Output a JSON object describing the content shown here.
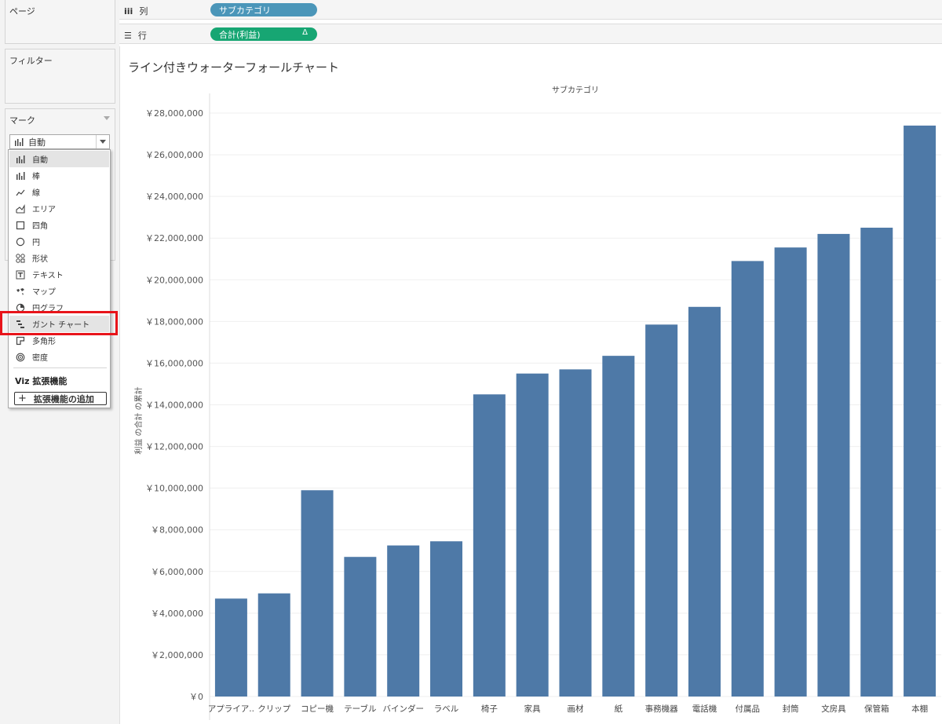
{
  "left": {
    "pages_title": "ページ",
    "filters_title": "フィルター",
    "marks_title": "マーク",
    "mark_type_selected": "自動",
    "mark_types": [
      {
        "icon": "auto-bars-icon",
        "label": "自動"
      },
      {
        "icon": "bar-icon",
        "label": "棒"
      },
      {
        "icon": "line-icon",
        "label": "線"
      },
      {
        "icon": "area-icon",
        "label": "エリア"
      },
      {
        "icon": "square-icon",
        "label": "四角"
      },
      {
        "icon": "circle-icon",
        "label": "円"
      },
      {
        "icon": "shape-icon",
        "label": "形状"
      },
      {
        "icon": "text-icon",
        "label": "テキスト"
      },
      {
        "icon": "map-icon",
        "label": "マップ"
      },
      {
        "icon": "pie-icon",
        "label": "円グラフ"
      },
      {
        "icon": "gantt-icon",
        "label": "ガント チャート"
      },
      {
        "icon": "polygon-icon",
        "label": "多角形"
      },
      {
        "icon": "density-icon",
        "label": "密度"
      }
    ],
    "extensions_heading": "Viz 拡張機能",
    "add_extension_label": "拡張機能の追加",
    "highlight_color": "#e8141a"
  },
  "shelves": {
    "columns_label": "列",
    "rows_label": "行",
    "columns_pill": "サブカテゴリ",
    "rows_pill": "合計(利益)",
    "rows_pill_delta": "Δ",
    "columns_pill_color": "#4b96b9",
    "rows_pill_color": "#17a673"
  },
  "view": {
    "title": "ライン付きウォーターフォールチャート"
  },
  "chart_data": {
    "type": "bar",
    "title": "ライン付きウォーターフォールチャート",
    "column_header": "サブカテゴリ",
    "ylabel": "利益 の合計 の累計",
    "xlabel": "",
    "bar_color": "#4e79a7",
    "grid": true,
    "ylim": [
      0,
      28000000
    ],
    "y_ticks": [
      "￥0",
      "￥2,000,000",
      "￥4,000,000",
      "￥6,000,000",
      "￥8,000,000",
      "￥10,000,000",
      "￥12,000,000",
      "￥14,000,000",
      "￥16,000,000",
      "￥18,000,000",
      "￥20,000,000",
      "￥22,000,000",
      "￥24,000,000",
      "￥26,000,000",
      "￥28,000,000"
    ],
    "y_tick_values": [
      0,
      2000000,
      4000000,
      6000000,
      8000000,
      10000000,
      12000000,
      14000000,
      16000000,
      18000000,
      20000000,
      22000000,
      24000000,
      26000000,
      28000000
    ],
    "categories": [
      "アプライア..",
      "クリップ",
      "コピー機",
      "テーブル",
      "バインダー",
      "ラベル",
      "椅子",
      "家具",
      "画材",
      "紙",
      "事務機器",
      "電話機",
      "付属品",
      "封筒",
      "文房具",
      "保管箱",
      "本棚"
    ],
    "values": [
      4700000,
      4950000,
      9900000,
      6700000,
      7250000,
      7450000,
      14500000,
      15500000,
      15700000,
      16350000,
      17850000,
      18700000,
      20900000,
      21550000,
      22200000,
      22500000,
      27400000
    ]
  }
}
